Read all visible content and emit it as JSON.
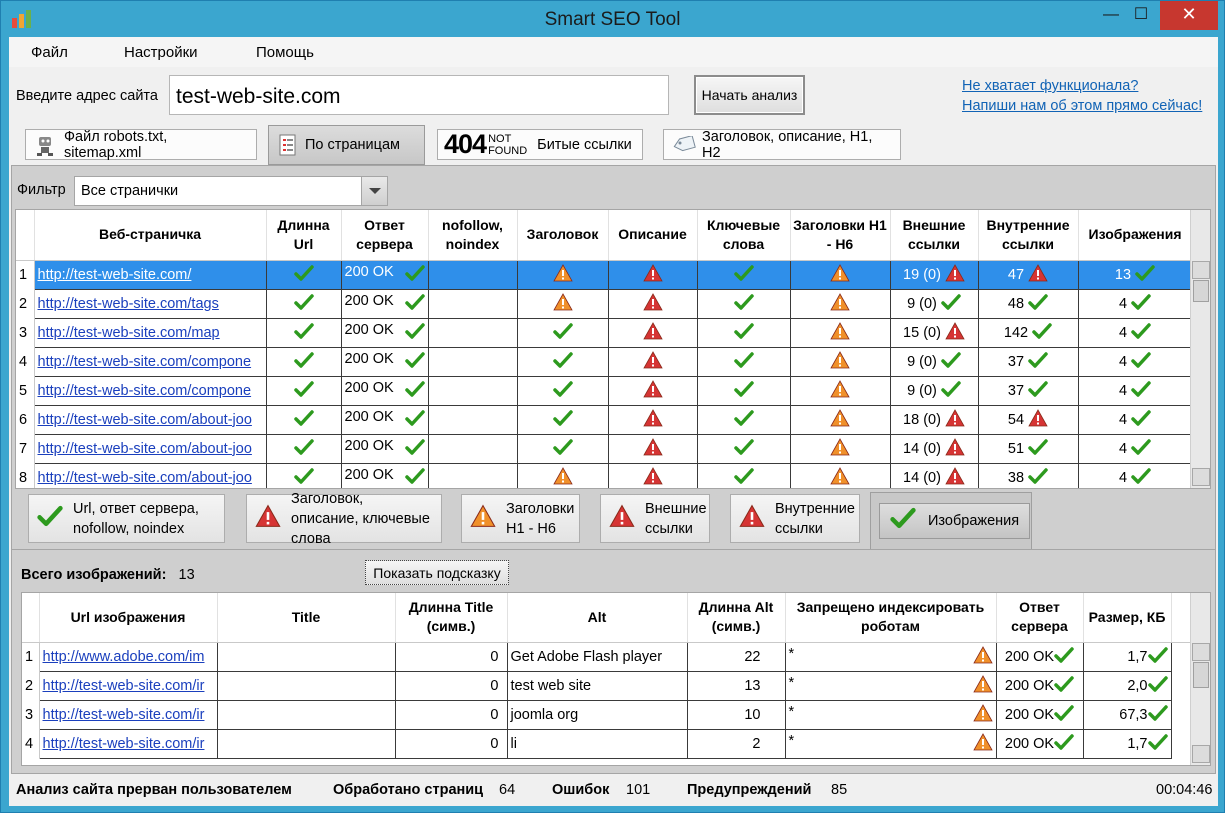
{
  "window": {
    "title": "Smart SEO Tool",
    "minimize": "—",
    "maximize": "☐",
    "close": "✕"
  },
  "menu": [
    "Файл",
    "Настройки",
    "Помощь"
  ],
  "address": {
    "label": "Введите адрес сайта",
    "value": "test-web-site.com",
    "start_button": "Начать анализ"
  },
  "help_links": [
    "Не хватает функционала?",
    "Напиши нам об этом прямо сейчас!"
  ],
  "tabs": [
    {
      "label": "Файл robots.txt, sitemap.xml",
      "icon": "robot-icon"
    },
    {
      "label": "По страницам",
      "icon": "pages-list-icon",
      "active": true
    },
    {
      "label": "Битые ссылки",
      "icon": "not-found-404-icon",
      "code": "404",
      "code_top": "NOT",
      "code_bottom": "FOUND"
    },
    {
      "label": "Заголовок, описание, H1, H2",
      "icon": "tag-icon"
    }
  ],
  "filter": {
    "label": "Фильтр",
    "value": "Все странички"
  },
  "pages_table": {
    "headers": [
      "Веб-страничка",
      "Длинна Url",
      "Ответ сервера",
      "nofollow, noindex",
      "Заголовок",
      "Описание",
      "Ключевые слова",
      "Заголовки H1 - H6",
      "Внешние ссылки",
      "Внутренние ссылки",
      "Изображения"
    ],
    "rows": [
      {
        "n": "1",
        "url": "http://test-web-site.com/",
        "len": "ok",
        "resp": "200 OK",
        "title": "warn",
        "desc": "error",
        "kw": "ok",
        "h": "warn",
        "ext": "19 (0)",
        "ext_s": "error",
        "int": "47",
        "int_s": "error",
        "img": "13",
        "img_s": "ok"
      },
      {
        "n": "2",
        "url": "http://test-web-site.com/tags",
        "len": "ok",
        "resp": "200 OK",
        "title": "warn",
        "desc": "error",
        "kw": "ok",
        "h": "warn",
        "ext": "9 (0)",
        "ext_s": "ok",
        "int": "48",
        "int_s": "ok",
        "img": "4",
        "img_s": "ok"
      },
      {
        "n": "3",
        "url": "http://test-web-site.com/map",
        "len": "ok",
        "resp": "200 OK",
        "title": "ok",
        "desc": "error",
        "kw": "ok",
        "h": "warn",
        "ext": "15 (0)",
        "ext_s": "error",
        "int": "142",
        "int_s": "ok",
        "img": "4",
        "img_s": "ok"
      },
      {
        "n": "4",
        "url": "http://test-web-site.com/compone",
        "len": "ok",
        "resp": "200 OK",
        "title": "ok",
        "desc": "error",
        "kw": "ok",
        "h": "warn",
        "ext": "9 (0)",
        "ext_s": "ok",
        "int": "37",
        "int_s": "ok",
        "img": "4",
        "img_s": "ok"
      },
      {
        "n": "5",
        "url": "http://test-web-site.com/compone",
        "len": "ok",
        "resp": "200 OK",
        "title": "ok",
        "desc": "error",
        "kw": "ok",
        "h": "warn",
        "ext": "9 (0)",
        "ext_s": "ok",
        "int": "37",
        "int_s": "ok",
        "img": "4",
        "img_s": "ok"
      },
      {
        "n": "6",
        "url": "http://test-web-site.com/about-joo",
        "len": "ok",
        "resp": "200 OK",
        "title": "ok",
        "desc": "error",
        "kw": "ok",
        "h": "warn",
        "ext": "18 (0)",
        "ext_s": "error",
        "int": "54",
        "int_s": "error",
        "img": "4",
        "img_s": "ok"
      },
      {
        "n": "7",
        "url": "http://test-web-site.com/about-joo",
        "len": "ok",
        "resp": "200 OK",
        "title": "ok",
        "desc": "error",
        "kw": "ok",
        "h": "warn",
        "ext": "14 (0)",
        "ext_s": "error",
        "int": "51",
        "int_s": "ok",
        "img": "4",
        "img_s": "ok"
      },
      {
        "n": "8",
        "url": "http://test-web-site.com/about-joo",
        "len": "ok",
        "resp": "200 OK",
        "title": "warn",
        "desc": "error",
        "kw": "ok",
        "h": "warn",
        "ext": "14 (0)",
        "ext_s": "error",
        "int": "38",
        "int_s": "ok",
        "img": "4",
        "img_s": "ok"
      }
    ]
  },
  "categories": [
    {
      "label": "Url, ответ сервера, nofollow, noindex",
      "icon": "check-icon"
    },
    {
      "label": "Заголовок, описание, ключевые слова",
      "icon": "error-icon"
    },
    {
      "label": "Заголовки H1 - H6",
      "icon": "warning-icon"
    },
    {
      "label": "Внешние ссылки",
      "icon": "error-icon"
    },
    {
      "label": "Внутренние ссылки",
      "icon": "error-icon"
    },
    {
      "label": "Изображения",
      "icon": "check-icon",
      "active": true
    }
  ],
  "images": {
    "total_label": "Всего изображений:",
    "total": "13",
    "hint_button": "Показать подсказку",
    "headers": [
      "Url изображения",
      "Title",
      "Длинна Title (симв.)",
      "Alt",
      "Длинна Alt (симв.)",
      "Запрещено индексировать роботам",
      "Ответ сервера",
      "Размер, КБ"
    ],
    "rows": [
      {
        "n": "1",
        "url": "http://www.adobe.com/im",
        "title": "",
        "tlen": "0",
        "alt": "Get Adobe Flash player",
        "alen": "22",
        "robots": "*",
        "resp": "200 OK",
        "size": "1,7"
      },
      {
        "n": "2",
        "url": "http://test-web-site.com/ir",
        "title": "",
        "tlen": "0",
        "alt": "test web site",
        "alen": "13",
        "robots": "*",
        "resp": "200 OK",
        "size": "2,0"
      },
      {
        "n": "3",
        "url": "http://test-web-site.com/ir",
        "title": "",
        "tlen": "0",
        "alt": "joomla org",
        "alen": "10",
        "robots": "*",
        "resp": "200 OK",
        "size": "67,3"
      },
      {
        "n": "4",
        "url": "http://test-web-site.com/ir",
        "title": "",
        "tlen": "0",
        "alt": "li",
        "alen": "2",
        "robots": "*",
        "resp": "200 OK",
        "size": "1,7"
      }
    ]
  },
  "status": {
    "message": "Анализ сайта прерван пользователем",
    "processed_label": "Обработано страниц",
    "processed": "64",
    "errors_label": "Ошибок",
    "errors": "101",
    "warnings_label": "Предупреждений",
    "warnings": "85",
    "time": "00:04:46"
  },
  "colors": {
    "ok": "#2d9a1e",
    "error": "#d63434",
    "warning": "#f0902a",
    "selection": "#2f8fea",
    "link": "#1a3fbd"
  }
}
